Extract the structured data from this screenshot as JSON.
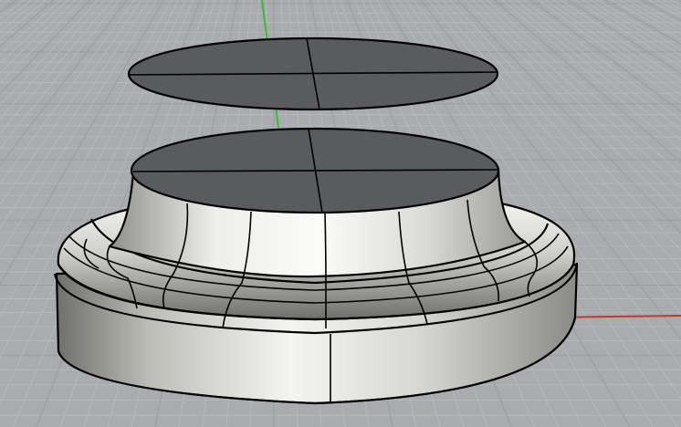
{
  "viewport": {
    "projection": "perspective",
    "display_mode": "shaded",
    "grid_visible": true,
    "axes_visible": true
  },
  "colors": {
    "background": "#a9abaf",
    "grid_minor": "#b9bbbf",
    "grid_major": "#9c9ea2",
    "x_axis": "#c0392b",
    "y_axis": "#2fbf2f",
    "edge": "#000000",
    "flat_face": "#5a5b5e",
    "surface_light": "#f2f2f0",
    "surface_mid": "#c8c8c4",
    "surface_dark": "#7a7a76"
  },
  "scene": {
    "objects": [
      {
        "name": "top-disc",
        "kind": "planar-surface"
      },
      {
        "name": "column-top-cap",
        "kind": "planar-surface"
      },
      {
        "name": "column-base",
        "kind": "revolved-polysurface"
      }
    ]
  }
}
